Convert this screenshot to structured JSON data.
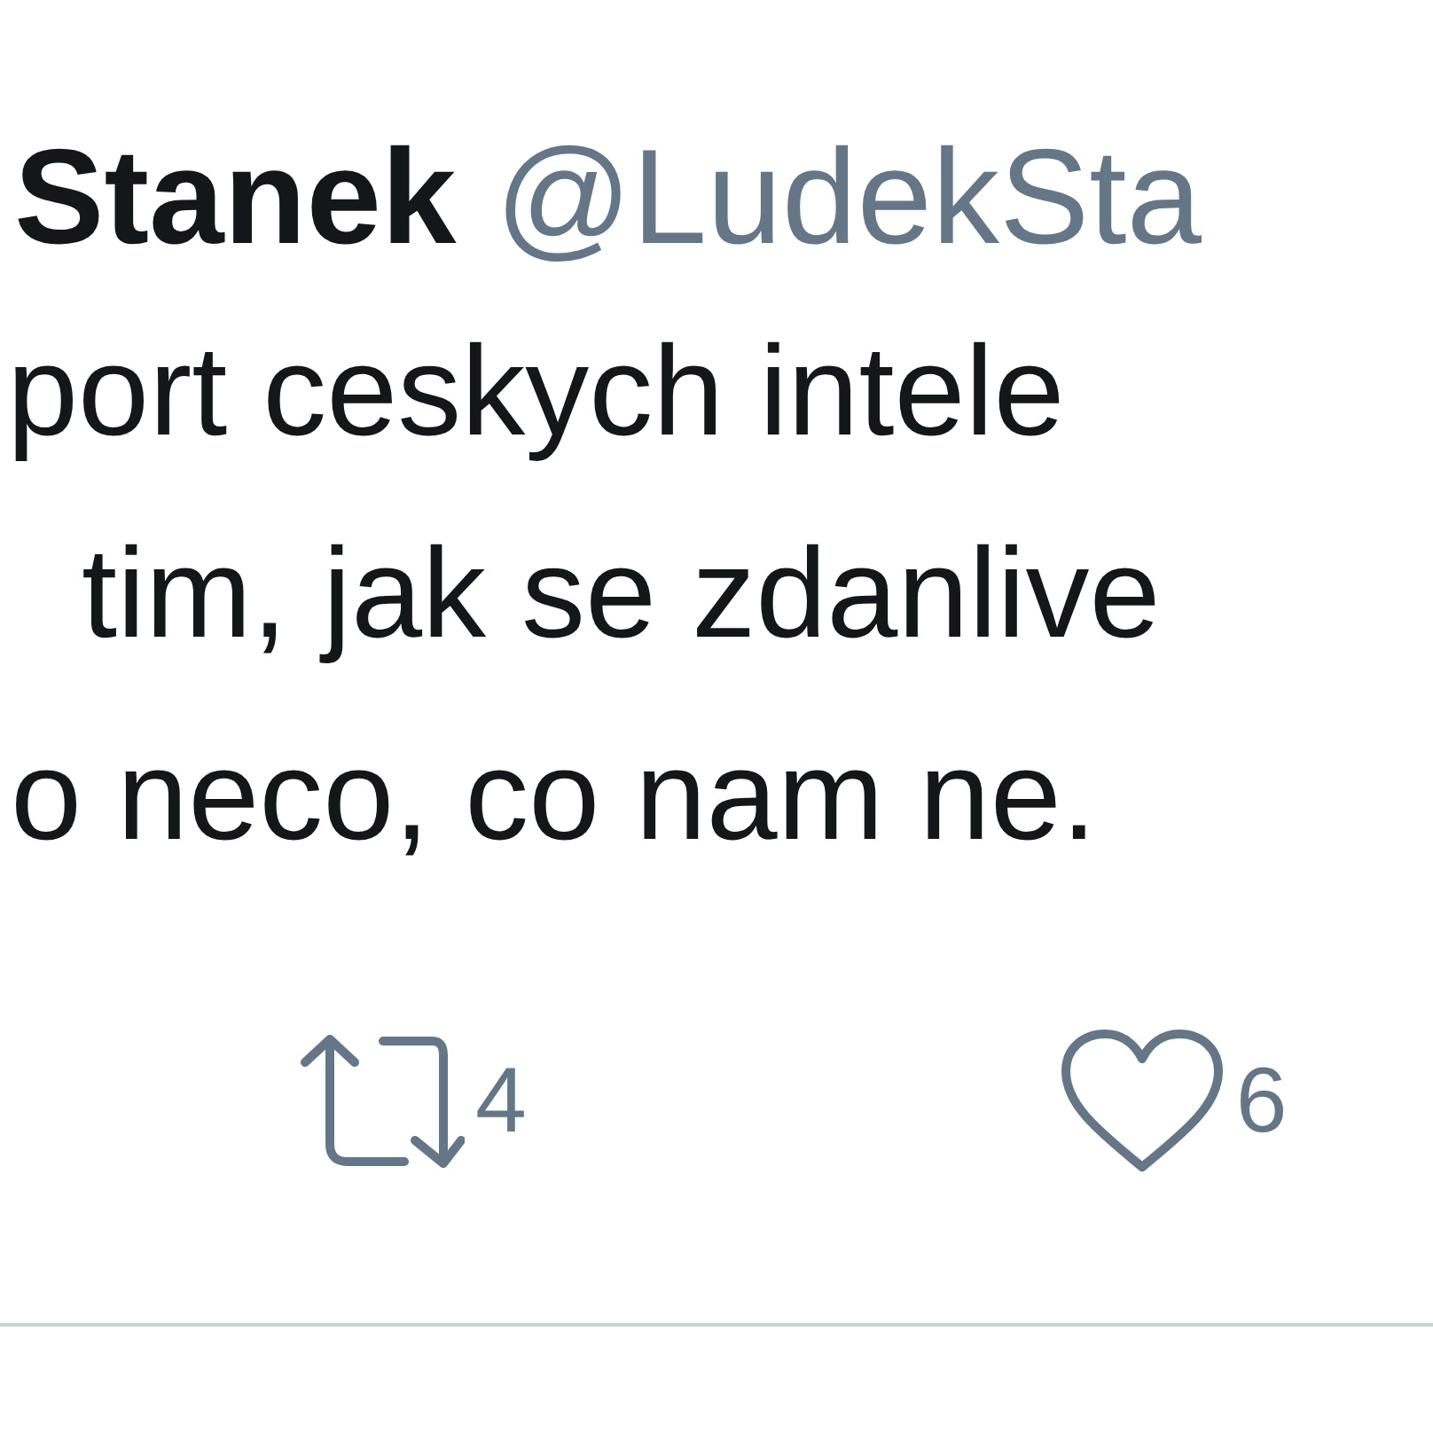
{
  "author": {
    "name": "Stanek",
    "handle": "@LudekSta"
  },
  "text_lines": [
    "port ceskych intele",
    "tim, jak se zdanlive",
    "o neco, co nam ne."
  ],
  "actions": [
    {
      "kind": "retweet",
      "count": "4"
    },
    {
      "kind": "like",
      "count": "6"
    }
  ]
}
